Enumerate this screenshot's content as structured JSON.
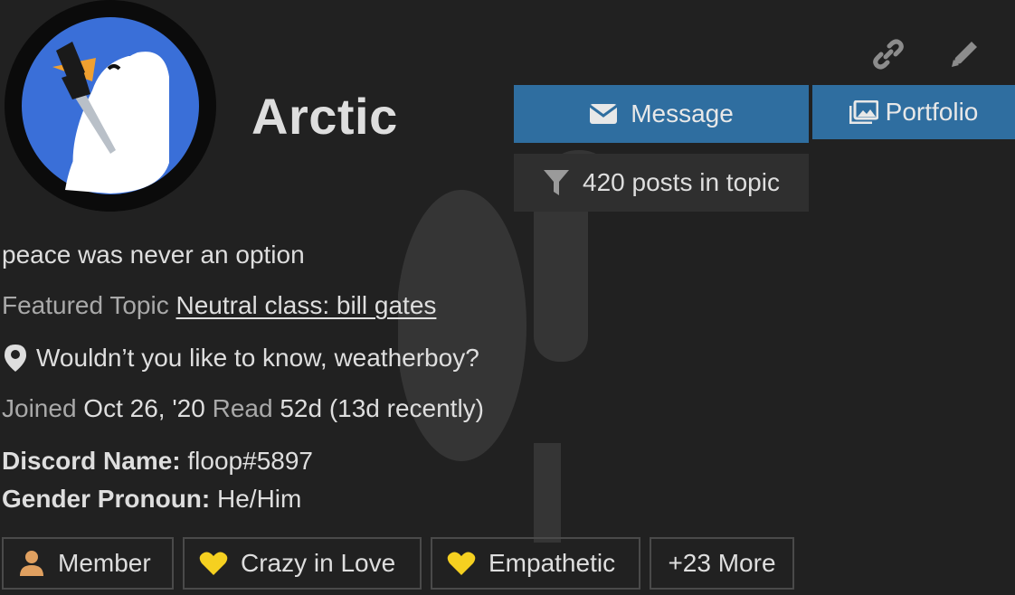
{
  "user": {
    "username": "Arctic",
    "bio": "peace was never an option"
  },
  "buttons": {
    "message_label": "Message",
    "portfolio_label": "Portfolio",
    "filter_label": "420 posts in topic"
  },
  "featured": {
    "label": "Featured Topic",
    "topic": "Neutral class: bill gates"
  },
  "location": "Wouldn’t you like to know, weatherboy?",
  "stats": {
    "joined_label": "Joined",
    "joined_value": "Oct 26, '20",
    "read_label": "Read",
    "read_value": "52d (13d recently)"
  },
  "fields": [
    {
      "label": "Discord Name:",
      "value": "floop#5897"
    },
    {
      "label": "Gender Pronoun:",
      "value": "He/Him"
    }
  ],
  "badges": [
    {
      "label": "Member",
      "icon": "user-icon",
      "color": "#e0a060"
    },
    {
      "label": "Crazy in Love",
      "icon": "heart-icon",
      "color": "#f5d020"
    },
    {
      "label": "Empathetic",
      "icon": "heart-icon",
      "color": "#f5d020"
    },
    {
      "label": "+23 More"
    }
  ],
  "colors": {
    "background": "#212121",
    "primary_button": "#2f6ea0",
    "avatar_blue": "#3a6fd8",
    "beak": "#f0a030"
  }
}
